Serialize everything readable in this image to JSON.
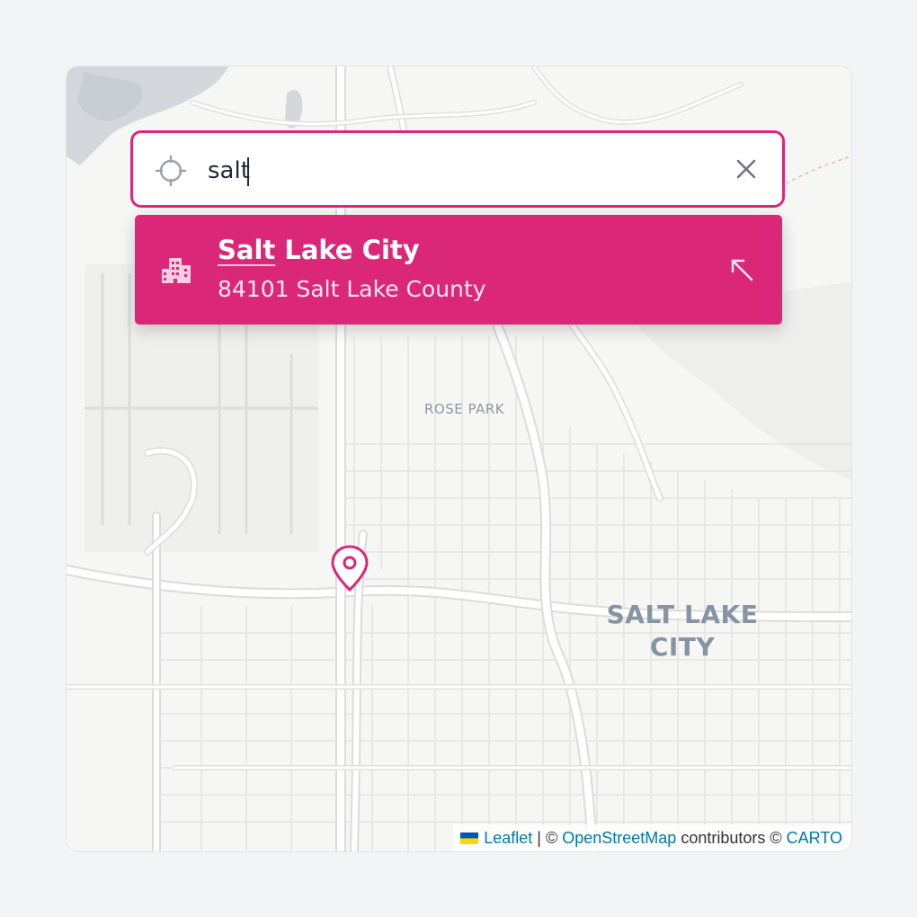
{
  "search": {
    "value": "salt",
    "placeholder": ""
  },
  "result": {
    "title_match": "Salt",
    "title_rest": " Lake City",
    "subtitle": "84101 Salt Lake County"
  },
  "map": {
    "district_label": "ROSE PARK",
    "city_label_line1": "SALT LAKE",
    "city_label_line2": "CITY"
  },
  "attribution": {
    "leaflet": "Leaflet",
    "sep1": " | © ",
    "osm": "OpenStreetMap",
    "contributors": " contributors © ",
    "carto": "CARTO"
  },
  "colors": {
    "accent": "#db2777",
    "link": "#0078a8",
    "water": "#d4d8dc",
    "road": "#ffffff",
    "background": "#f6f6f4"
  },
  "icons": {
    "search": "crosshair-icon",
    "clear": "close-icon",
    "result": "city-buildings-icon",
    "fill": "arrow-up-left-icon",
    "marker": "map-pin-icon"
  }
}
